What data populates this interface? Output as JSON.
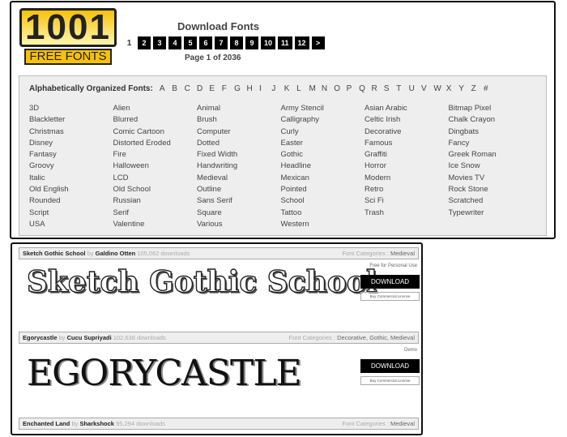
{
  "logo": {
    "number": "1001",
    "text": "FREE FONTS"
  },
  "header": {
    "title": "Download Fonts",
    "current_page": "1",
    "pages": [
      "2",
      "3",
      "4",
      "5",
      "6",
      "7",
      "8",
      "9",
      "10",
      "11",
      "12",
      ">"
    ],
    "page_of": "Page 1 of 2036"
  },
  "alpha": {
    "label": "Alphabetically Organized Fonts:",
    "letters": [
      "A",
      "B",
      "C",
      "D",
      "E",
      "F",
      "G",
      "H",
      "I",
      "J",
      "K",
      "L",
      "M",
      "N",
      "O",
      "P",
      "Q",
      "R",
      "S",
      "T",
      "U",
      "V",
      "W",
      "X",
      "Y",
      "Z",
      "#"
    ]
  },
  "categories": [
    [
      "3D",
      "Blackletter",
      "Christmas",
      "Disney",
      "Fantasy",
      "Groovy",
      "Italic",
      "Old English",
      "Rounded",
      "Script",
      "USA"
    ],
    [
      "Alien",
      "Blurred",
      "Comic Cartoon",
      "Distorted Eroded",
      "Fire",
      "Halloween",
      "LCD",
      "Old School",
      "Russian",
      "Serif",
      "Valentine"
    ],
    [
      "Animal",
      "Brush",
      "Computer",
      "Dotted",
      "Fixed Width",
      "Handwriting",
      "Medieval",
      "Outline",
      "Sans Serif",
      "Square",
      "Various"
    ],
    [
      "Army Stencil",
      "Calligraphy",
      "Curly",
      "Easter",
      "Gothic",
      "Headline",
      "Mexican",
      "Pointed",
      "School",
      "Tattoo",
      "Western"
    ],
    [
      "Asian Arabic",
      "Celtic Irish",
      "Decorative",
      "Famous",
      "Graffiti",
      "Horror",
      "Modern",
      "Retro",
      "Sci Fi",
      "Trash"
    ],
    [
      "Bitmap Pixel",
      "Chalk Crayon",
      "Dingbats",
      "Fancy",
      "Greek Roman",
      "Ice Snow",
      "Movies TV",
      "Rock Stone",
      "Scratched",
      "Typewriter"
    ]
  ],
  "fonts": [
    {
      "name": "Sketch Gothic School",
      "by": "by",
      "author": "Galdino Otten",
      "downloads": "105,062 downloads",
      "cat_label": "Font Categories :",
      "cats": "Medieval",
      "preview": "Sketch Gothic School",
      "license": "Free for Personal Use",
      "download": "DOWNLOAD",
      "buy": "Buy Commercial License"
    },
    {
      "name": "Egorycastle",
      "by": "by",
      "author": "Cucu Supriyadi",
      "downloads": "102,638 downloads",
      "cat_label": "Font Categories :",
      "cats": "Decorative, Gothic, Medieval",
      "preview": "EGORYCASTLE",
      "license": "Demo",
      "download": "DOWNLOAD",
      "buy": "Buy Commercial License"
    },
    {
      "name": "Enchanted Land",
      "by": "by",
      "author": "Sharkshock",
      "downloads": "95,294 downloads",
      "cat_label": "Font Categories :",
      "cats": "Medieval"
    }
  ]
}
